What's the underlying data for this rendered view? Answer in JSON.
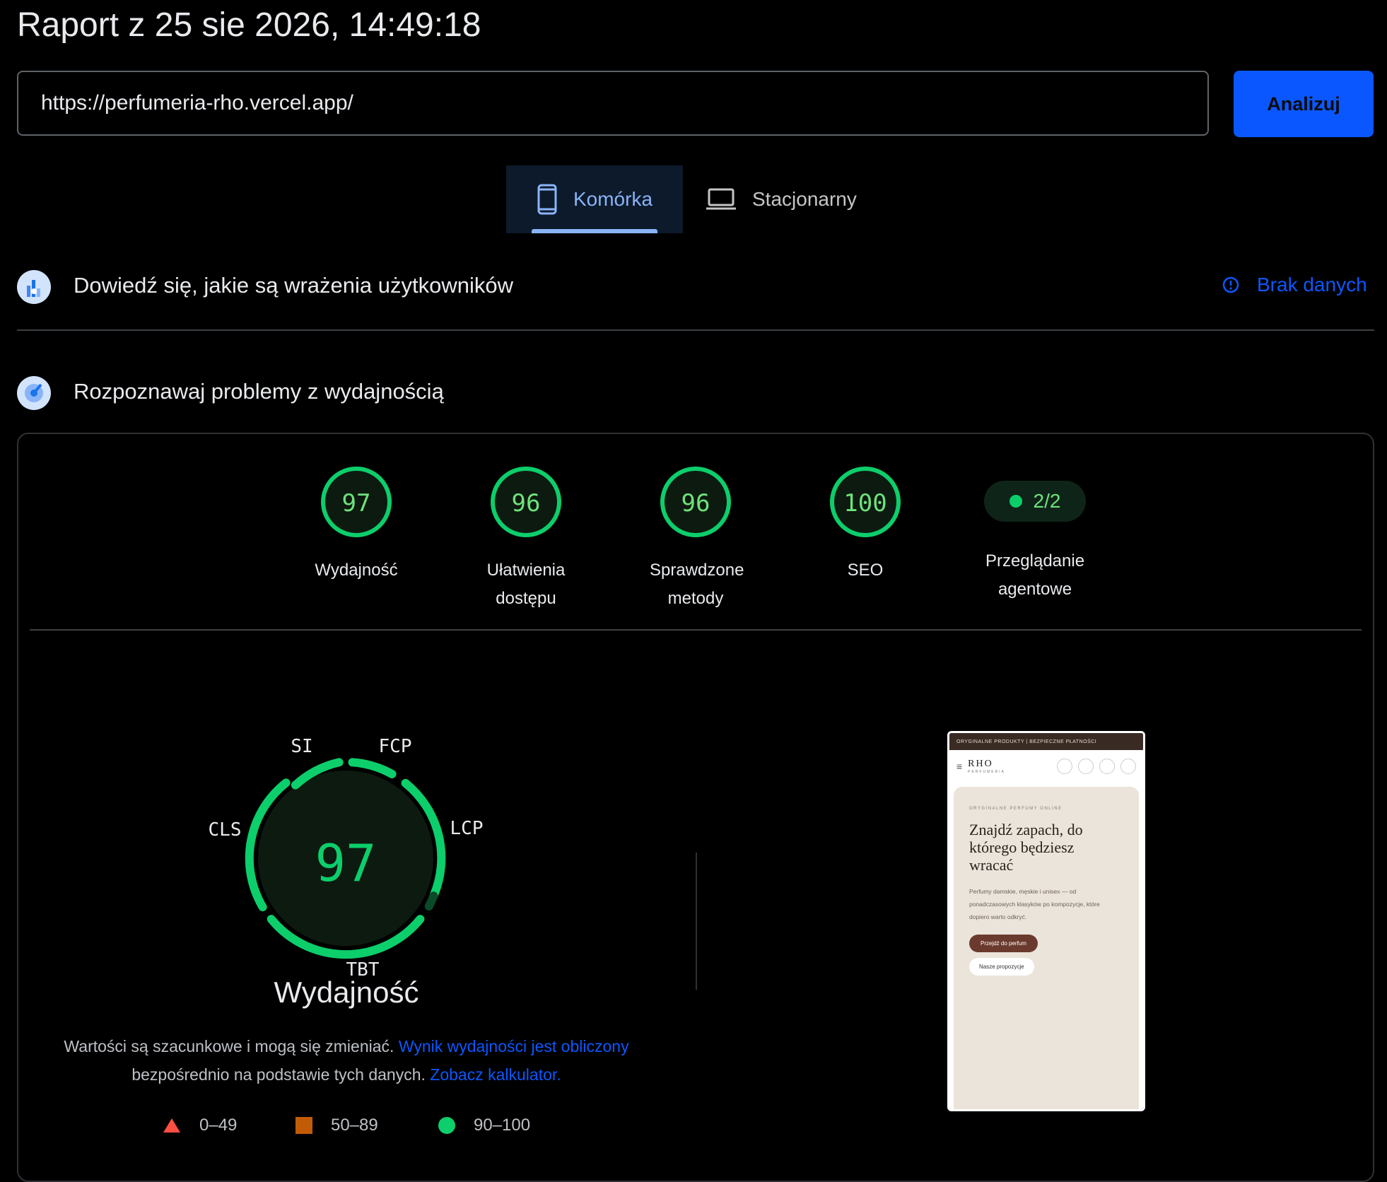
{
  "header": {
    "title": "Raport z 25 sie 2026, 14:49:18"
  },
  "url_input": {
    "value": "https://perfumeria-rho.vercel.app/"
  },
  "analyze_button": {
    "label": "Analizuj"
  },
  "tabs": {
    "mobile": "Komórka",
    "desktop": "Stacjonarny"
  },
  "field_section": {
    "title": "Dowiedź się, jakie są wrażenia użytkowników",
    "status": "Brak danych"
  },
  "lab_section": {
    "title": "Rozpoznawaj problemy z wydajnością"
  },
  "scores": [
    {
      "value": "97",
      "label_line1": "Wydajność",
      "label_line2": ""
    },
    {
      "value": "96",
      "label_line1": "Ułatwienia",
      "label_line2": "dostępu"
    },
    {
      "value": "96",
      "label_line1": "Sprawdzone",
      "label_line2": "metody"
    },
    {
      "value": "100",
      "label_line1": "SEO",
      "label_line2": ""
    }
  ],
  "agentic": {
    "value": "2/2",
    "label_line1": "Przeglądanie",
    "label_line2": "agentowe"
  },
  "performance": {
    "score": "97",
    "title": "Wydajność",
    "metrics": {
      "si": "SI",
      "fcp": "FCP",
      "lcp": "LCP",
      "tbt": "TBT",
      "cls": "CLS"
    }
  },
  "note": {
    "text1": "Wartości są szacunkowe i mogą się zmieniać. ",
    "link1": "Wynik wydajności jest obliczony",
    "text2": " bezpośrednio na podstawie tych danych. ",
    "link2": "Zobacz kalkulator."
  },
  "legend": {
    "poor": "0–49",
    "average": "50–89",
    "good": "90–100"
  },
  "colors": {
    "good": "#0cce6b",
    "average": "#c25b06",
    "poor": "#ff4e42",
    "accent": "#0b57ff"
  },
  "thumbnail": {
    "topbar": "ORYGINALNE PRODUKTY | BEZPIECZNE PŁATNOŚCI",
    "brand": "RHO",
    "brand_sub": "PERFUMERIA",
    "eyebrow": "ORYGINALNE PERFUMY ONLINE",
    "headline": "Znajdź zapach, do którego będziesz wracać",
    "body": "Perfumy damskie, męskie i unisex — od ponadczasowych klasyków po kompozycje, które dopiero warto odkryć.",
    "cta_primary": "Przejdź do perfum",
    "cta_secondary": "Nasze propozycje"
  }
}
